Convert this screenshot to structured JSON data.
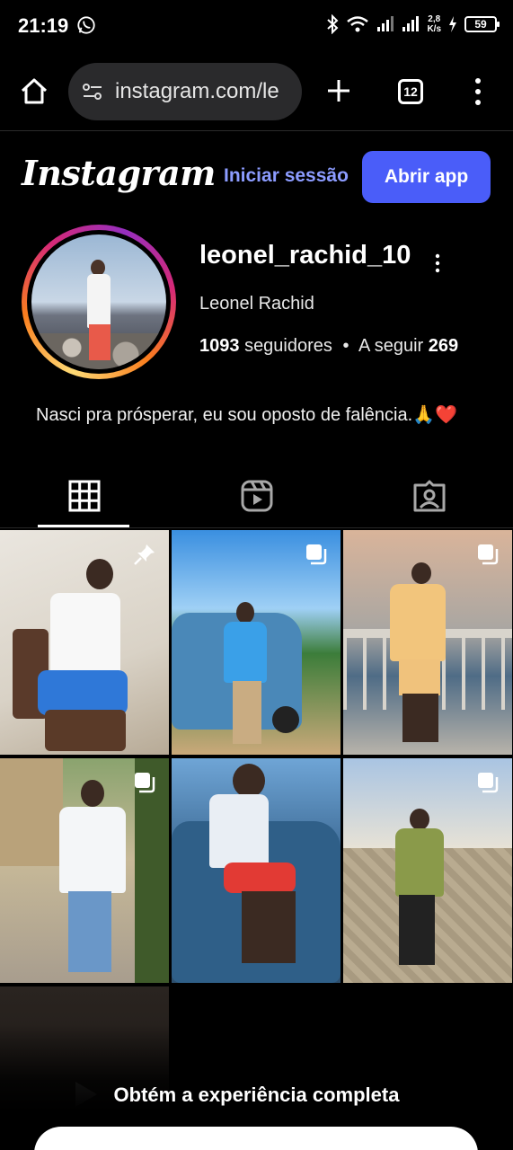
{
  "status_bar": {
    "time": "21:19",
    "speed_value": "2,8",
    "speed_unit": "K/s",
    "battery": "59"
  },
  "browser": {
    "url": "instagram.com/le",
    "tab_count": "12"
  },
  "header": {
    "logo": "Instagram",
    "login_label": "Iniciar sessão",
    "open_app_label": "Abrir app"
  },
  "profile": {
    "username": "leonel_rachid_10",
    "full_name": "Leonel Rachid",
    "followers_count": "1093",
    "followers_label": "seguidores",
    "following_label": "A seguir",
    "following_count": "269",
    "bio": "Nasci pra prósperar, eu sou oposto de falência.🙏❤️"
  },
  "tabs": [
    {
      "icon": "grid-icon",
      "active": true
    },
    {
      "icon": "reels-icon",
      "active": false
    },
    {
      "icon": "tagged-icon",
      "active": false
    }
  ],
  "posts": [
    {
      "overlay_icon": "pin-icon"
    },
    {
      "overlay_icon": "carousel-icon"
    },
    {
      "overlay_icon": "carousel-icon"
    },
    {
      "overlay_icon": "carousel-icon"
    },
    {
      "overlay_icon": ""
    },
    {
      "overlay_icon": "carousel-icon"
    },
    {
      "overlay_icon": ""
    }
  ],
  "cta": {
    "title": "Obtém a experiência completa"
  },
  "colors": {
    "accent_button": "#4a5df9",
    "link": "#8c9cff",
    "background": "#000000"
  }
}
